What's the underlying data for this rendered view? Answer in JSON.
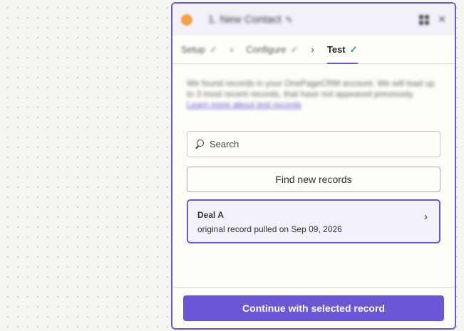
{
  "header": {
    "step_title": "1. New Contact",
    "app_icon": "onepagecrm-logo",
    "edit_icon": "pencil-icon",
    "expand_icon": "grid-icon",
    "close_icon": "close-icon"
  },
  "tabs": [
    {
      "label": "Setup",
      "done": true
    },
    {
      "label": "Configure",
      "done": true
    },
    {
      "label": "Test",
      "done": true,
      "active": true
    }
  ],
  "info": {
    "text": "We found records in your OnePageCRM account. We will load up to 3 most recent records, that have not appeared previously.",
    "link": "Learn more about test records"
  },
  "search": {
    "placeholder": "Search"
  },
  "find_button": "Find new records",
  "records": [
    {
      "title": "Deal A",
      "subtitle": "original record pulled on Sep 09, 2026"
    }
  ],
  "footer": {
    "continue_label": "Continue with selected record"
  },
  "colors": {
    "accent": "#6b57d6",
    "success": "#2b9b5b",
    "app_icon": "#f1a248"
  }
}
